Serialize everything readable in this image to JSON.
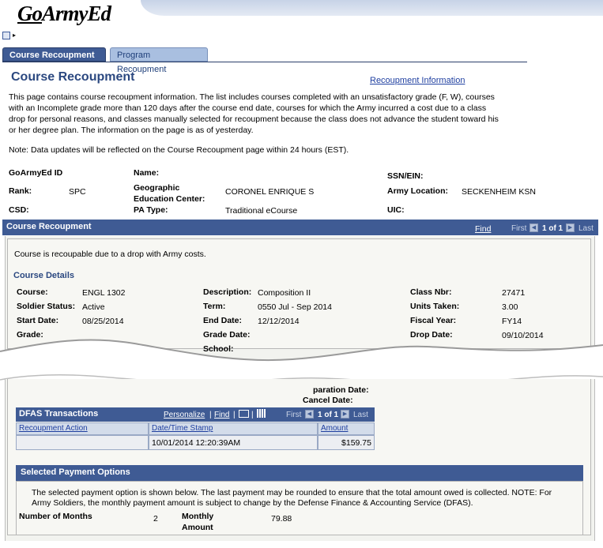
{
  "header": {
    "logo_go": "Go",
    "logo_rest": "ArmyEd",
    "menu_arrow": "▸"
  },
  "tabs": [
    {
      "label": "Course Recoupment",
      "active": true
    },
    {
      "label": "Program Recoupment",
      "active": false
    }
  ],
  "page": {
    "title": "Course Recoupment",
    "info_link": "Recoupment Information",
    "intro": "This page contains course recoupment information. The list includes courses completed with an unsatisfactory grade (F, W), courses with an Incomplete grade more than 120 days after the course end date, courses for which the Army incurred a cost due to a class drop for personal reasons, and classes manually selected for recoupment because the class does not advance the student toward his or her degree plan. The information on the page is as of yesterday.",
    "note": "Note: Data updates will be reflected on the Course Recoupment page within 24 hours (EST)."
  },
  "soldier": {
    "goarmyed_id_label": "GoArmyEd ID",
    "name_label": "Name:",
    "ssn_label": "SSN/EIN:",
    "rank_label": "Rank:",
    "rank_value": "SPC",
    "gec_label_1": "Geographic",
    "gec_label_2": "Education Center:",
    "gec_value": "CORONEL ENRIQUE S",
    "army_location_label": "Army Location:",
    "army_location_value": "SECKENHEIM KSN",
    "csd_label": "CSD:",
    "pa_type_label": "PA Type:",
    "pa_type_value": "Traditional eCourse",
    "uic_label": "UIC:"
  },
  "grid": {
    "title": "Course Recoupment",
    "find": "Find",
    "first": "First",
    "count": "1 of 1",
    "last": "Last",
    "prev_icon": "◀",
    "next_icon": "▶"
  },
  "course": {
    "message": "Course is recoupable due to a drop with Army costs.",
    "section_title": "Course Details",
    "course_label": "Course:",
    "course_value": "ENGL 1302",
    "description_label": "Description:",
    "description_value": "Composition II",
    "class_nbr_label": "Class Nbr:",
    "class_nbr_value": "27471",
    "soldier_status_label": "Soldier Status:",
    "soldier_status_value": "Active",
    "term_label": "Term:",
    "term_value": "0550  Jul - Sep 2014",
    "units_label": "Units Taken:",
    "units_value": "3.00",
    "start_label": "Start Date:",
    "start_value": "08/25/2014",
    "end_label": "End Date:",
    "end_value": "12/12/2014",
    "fiscal_label": "Fiscal Year:",
    "fiscal_value": "FY14",
    "grade_label_left": "Grade:",
    "grade_date_label": "Grade Date:",
    "drop_label": "Drop Date:",
    "drop_value": "09/10/2014",
    "school_label": "School:",
    "separation_label": "paration Date:",
    "cancel_label": "Cancel Date:"
  },
  "dfas": {
    "title": "DFAS Transactions",
    "personalize": "Personalize",
    "find": "Find",
    "first": "First",
    "count": "1 of 1",
    "last": "Last",
    "columns": [
      "Recoupment Action",
      "Date/Time Stamp",
      "Amount"
    ],
    "row": {
      "action": "",
      "timestamp": "10/01/2014 12:20:39AM",
      "amount": "$159.75"
    }
  },
  "payment": {
    "title": "Selected Payment Options",
    "text": "The selected payment option is shown below. The last payment may be rounded to ensure that the total amount owed is collected. NOTE: For Army Soldiers, the monthly payment amount is subject to change by the Defense Finance & Accounting Service (DFAS).",
    "months_label": "Number of Months",
    "months_value": "2",
    "monthly_label_1": "Monthly",
    "monthly_label_2": "Amount",
    "monthly_value": "79.88"
  }
}
